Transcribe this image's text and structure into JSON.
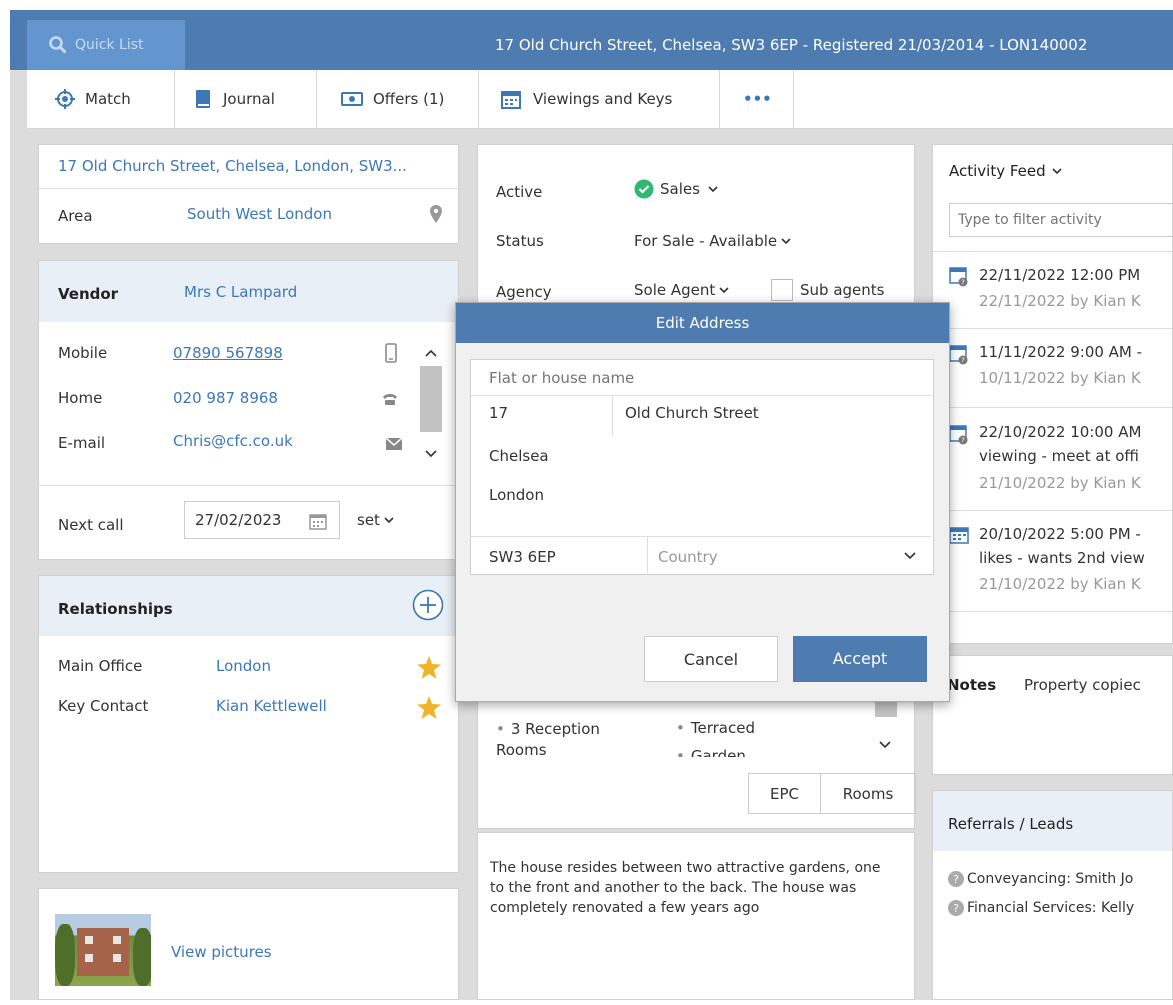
{
  "header": {
    "quick_list": "Quick List",
    "title": "17 Old Church Street, Chelsea, SW3 6EP - Registered 21/03/2014 - LON140002"
  },
  "toolbar": {
    "match": "Match",
    "journal": "Journal",
    "offers": "Offers (1)",
    "viewings": "Viewings and Keys",
    "more": "•••"
  },
  "address_panel": {
    "address": "17 Old Church Street, Chelsea, London, SW3...",
    "area_label": "Area",
    "area_value": "South West London"
  },
  "vendor_panel": {
    "label": "Vendor",
    "name": "Mrs C Lampard",
    "mobile_label": "Mobile",
    "mobile": "07890 567898",
    "home_label": "Home",
    "home": "020 987 8968",
    "email_label": "E-mail",
    "email": "Chris@cfc.co.uk",
    "next_call_label": "Next call",
    "next_call_date": "27/02/2023",
    "set_label": "set"
  },
  "relationships": {
    "title": "Relationships",
    "items": [
      {
        "label": "Main Office",
        "value": "London"
      },
      {
        "label": "Key Contact",
        "value": "Kian Kettlewell"
      }
    ]
  },
  "pictures": {
    "link": "View pictures"
  },
  "status_panel": {
    "active_label": "Active",
    "active_value": "Sales",
    "status_label": "Status",
    "status_value": "For Sale - Available",
    "agency_label": "Agency",
    "agency_value": "Sole Agent",
    "sub_agents": "Sub agents"
  },
  "features": {
    "left": "3 Reception Rooms",
    "right1": "Terraced",
    "right2": "Garden",
    "epc": "EPC",
    "rooms": "Rooms"
  },
  "description": "The house resides between two attractive gardens, one to the front and another to the back. The house was completely renovated a few years ago",
  "modal": {
    "title": "Edit Address",
    "flat_placeholder": "Flat or house name",
    "number": "17",
    "street": "Old Church Street",
    "locality": "Chelsea",
    "town": "London",
    "postcode": "SW3 6EP",
    "country_placeholder": "Country",
    "cancel": "Cancel",
    "accept": "Accept"
  },
  "activity": {
    "title": "Activity Feed",
    "filter_placeholder": "Type to filter activity",
    "items": [
      {
        "line1": "22/11/2022 12:00 PM",
        "line2": "",
        "line3": "22/11/2022 by Kian K"
      },
      {
        "line1": "11/11/2022 9:00 AM -",
        "line2": "",
        "line3": "10/11/2022 by Kian K"
      },
      {
        "line1": "22/10/2022 10:00 AM",
        "line2": "viewing - meet at offi",
        "line3": "21/10/2022 by Kian K"
      },
      {
        "line1": "20/10/2022 5:00 PM -",
        "line2": "likes - wants 2nd view",
        "line3": "21/10/2022 by Kian K"
      }
    ]
  },
  "notes": {
    "label": "Notes",
    "text": "Property copiec"
  },
  "referrals": {
    "title": "Referrals / Leads",
    "items": [
      "Conveyancing: Smith Jo",
      "Financial Services: Kelly"
    ]
  },
  "colors": {
    "accent": "#4e7bb0",
    "link": "#3c78b8",
    "star": "#f0b429",
    "check": "#2eb872"
  }
}
